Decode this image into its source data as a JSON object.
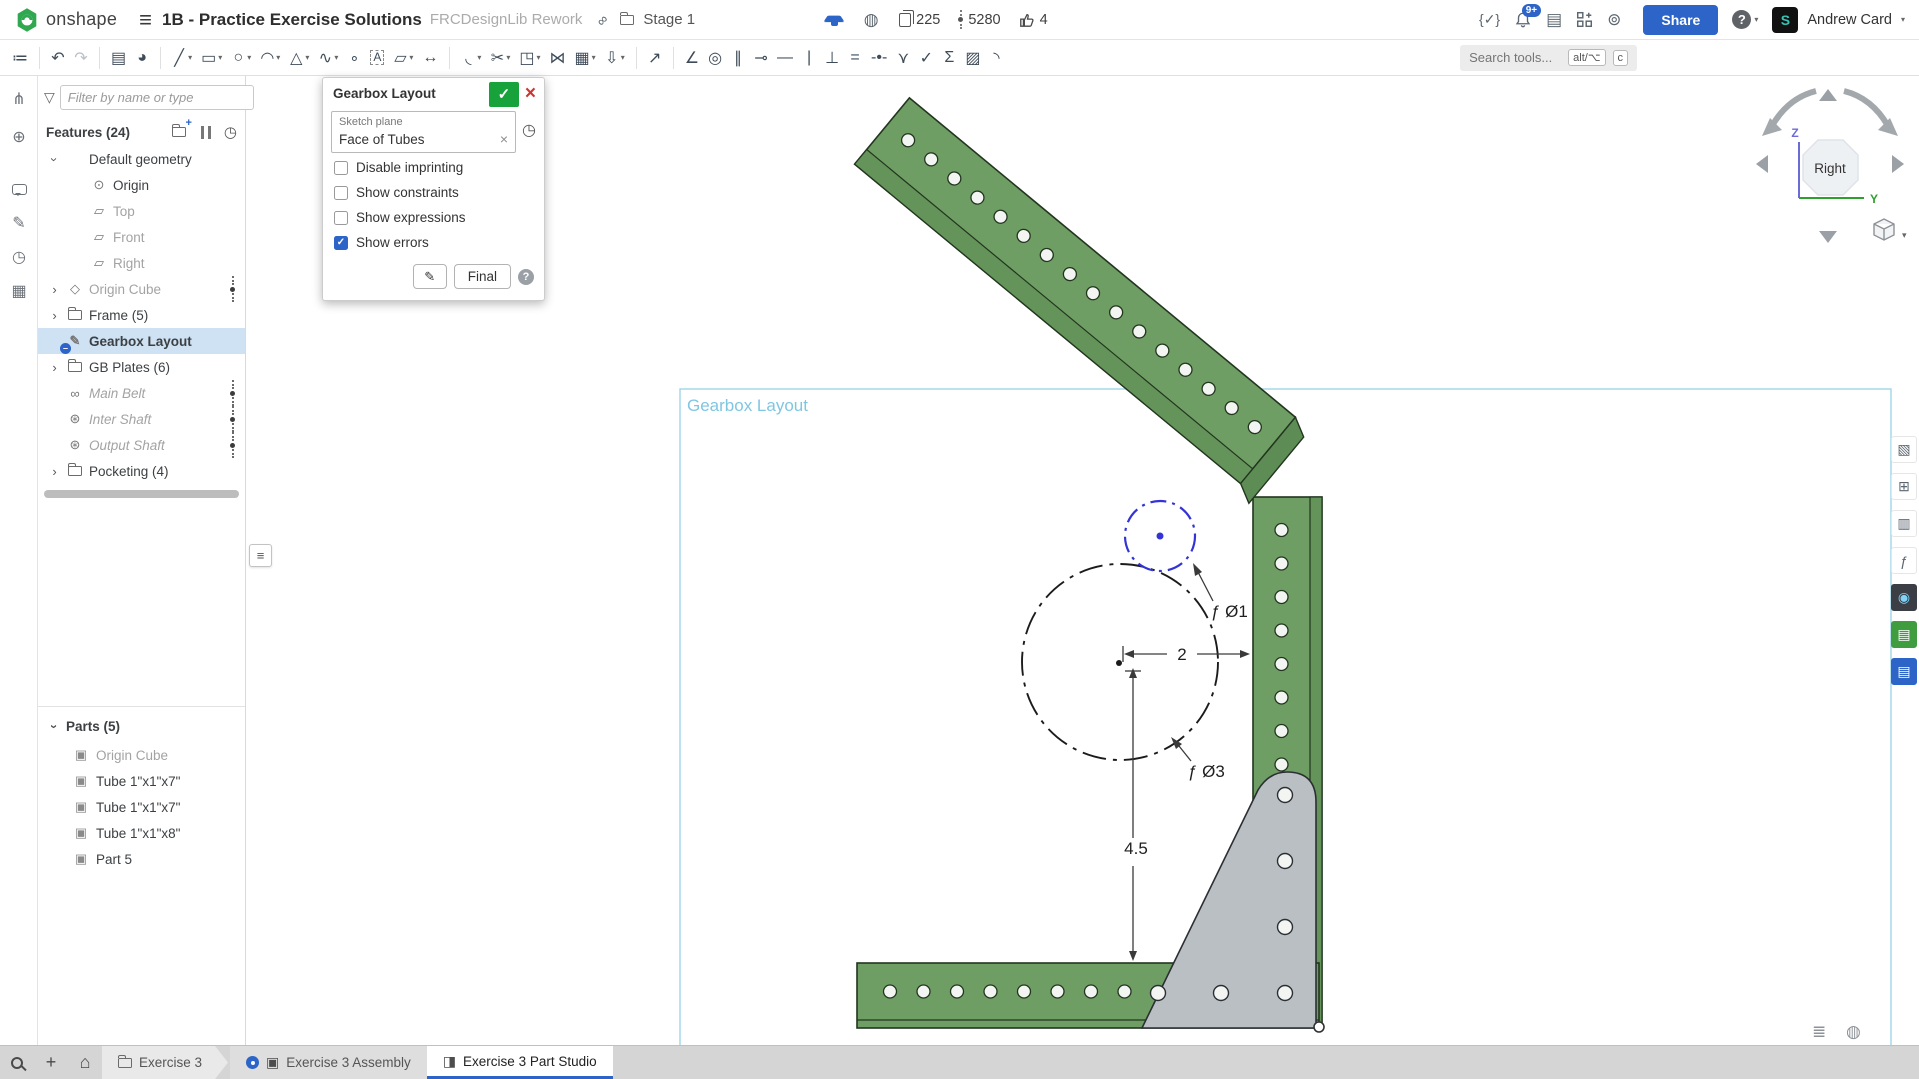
{
  "header": {
    "logo_text": "onshape",
    "title": "1B - Practice Exercise Solutions",
    "subtitle": "FRCDesignLib Rework",
    "folder_label": "Stage 1",
    "stat_copies": "225",
    "stat_points": "5280",
    "stat_likes": "4",
    "notification_badge": "9+",
    "share_label": "Share",
    "user_name": "Andrew Card",
    "avatar_initial": "S"
  },
  "toolbar": {
    "search_placeholder": "Search tools...",
    "kbd_alt": "alt/⌥",
    "kbd_c": "c",
    "caret_glyph": "▾",
    "tools": [
      {
        "name": "feature-list-toggle-icon",
        "glyph": "≔"
      },
      {
        "div": true
      },
      {
        "name": "undo-icon",
        "glyph": "↶"
      },
      {
        "name": "redo-icon",
        "glyph": "↷",
        "dim": true
      },
      {
        "div": true
      },
      {
        "name": "copy-properties-icon",
        "glyph": "▤"
      },
      {
        "name": "appearance-tool-icon",
        "glyph": "◕"
      },
      {
        "div": true
      },
      {
        "name": "line-tool-icon",
        "glyph": "╱",
        "caret": true
      },
      {
        "name": "rectangle-tool-icon",
        "glyph": "▭",
        "caret": true
      },
      {
        "name": "circle-tool-icon",
        "glyph": "○",
        "caret": true
      },
      {
        "name": "arc-tool-icon",
        "glyph": "◠",
        "caret": true
      },
      {
        "name": "polygon-tool-icon",
        "glyph": "△",
        "caret": true
      },
      {
        "name": "spline-tool-icon",
        "glyph": "∿",
        "caret": true
      },
      {
        "name": "point-tool-icon",
        "glyph": "∘"
      },
      {
        "name": "text-tool-icon",
        "glyph": "A",
        "box": true
      },
      {
        "name": "slot-tool-icon",
        "glyph": "▱",
        "caret": true
      },
      {
        "name": "dimension-tool-icon",
        "glyph": "↔"
      },
      {
        "div": true
      },
      {
        "name": "fillet-tool-icon",
        "glyph": "◟",
        "caret": true
      },
      {
        "name": "trim-tool-icon",
        "glyph": "✂",
        "caret": true
      },
      {
        "name": "offset-tool-icon",
        "glyph": "◳",
        "caret": true
      },
      {
        "name": "mirror-tool-icon",
        "glyph": "⋈"
      },
      {
        "name": "pattern-tool-icon",
        "glyph": "▦",
        "caret": true
      },
      {
        "name": "import-dxf-icon",
        "glyph": "⇩",
        "caret": true
      },
      {
        "div": true
      },
      {
        "name": "measure-icon",
        "glyph": "↗"
      },
      {
        "div": true
      },
      {
        "name": "coincident-constraint-icon",
        "glyph": "∠"
      },
      {
        "name": "concentric-constraint-icon",
        "glyph": "◎"
      },
      {
        "name": "parallel-constraint-icon",
        "glyph": "∥"
      },
      {
        "name": "tangent-constraint-icon",
        "glyph": "⊸"
      },
      {
        "name": "horizontal-constraint-icon",
        "glyph": "—"
      },
      {
        "name": "vertical-constraint-icon",
        "glyph": "|"
      },
      {
        "name": "perpendicular-constraint-icon",
        "glyph": "⊥"
      },
      {
        "name": "equal-constraint-icon",
        "glyph": "="
      },
      {
        "name": "midpoint-constraint-icon",
        "glyph": "-•-"
      },
      {
        "name": "pierce-constraint-icon",
        "glyph": "⋎"
      },
      {
        "name": "normal-constraint-icon",
        "glyph": "✓"
      },
      {
        "name": "sketch-expressions-icon",
        "glyph": "Σ"
      },
      {
        "name": "fix-constraint-icon",
        "glyph": "▨"
      },
      {
        "name": "curvature-comb-icon",
        "glyph": "◝"
      }
    ]
  },
  "left_strip": {
    "items": [
      {
        "name": "versions-icon",
        "glyph": "⋔"
      },
      {
        "name": "follow-mode-icon",
        "glyph": "⊕"
      },
      {
        "name": "comments-icon",
        "type": "bubble"
      },
      {
        "name": "feedback-icon",
        "glyph": "✎"
      },
      {
        "name": "history-icon",
        "glyph": "◷"
      },
      {
        "name": "tables-icon",
        "glyph": "▦"
      }
    ]
  },
  "features_panel": {
    "filter_placeholder": "Filter by name or type",
    "features_header": "Features (24)",
    "items": [
      {
        "label": "Default geometry",
        "chevron": "open"
      },
      {
        "label": "Origin",
        "icon": "origin",
        "child": true
      },
      {
        "label": "Top",
        "icon": "plane",
        "child": true,
        "gray": true
      },
      {
        "label": "Front",
        "icon": "plane",
        "child": true,
        "gray": true
      },
      {
        "label": "Right",
        "icon": "plane",
        "child": true,
        "gray": true
      },
      {
        "label": "Origin Cube",
        "icon": "cube",
        "chevron": "closed",
        "gray": true,
        "dots": true
      },
      {
        "label": "Frame (5)",
        "icon": "folder",
        "chevron": "closed"
      },
      {
        "label": "Gearbox Layout",
        "icon": "sketch",
        "selected": true,
        "badge": "–"
      },
      {
        "label": "GB Plates (6)",
        "icon": "folder",
        "chevron": "closed"
      },
      {
        "label": "Main Belt",
        "icon": "belt",
        "gray": true,
        "italic": true,
        "dots": true
      },
      {
        "label": "Inter Shaft",
        "icon": "gear",
        "gray": true,
        "italic": true,
        "dots": true
      },
      {
        "label": "Output Shaft",
        "icon": "gear",
        "gray": true,
        "italic": true,
        "dots": true
      },
      {
        "label": "Pocketing (4)",
        "icon": "folder",
        "chevron": "closed"
      }
    ],
    "parts_header": "Parts (5)",
    "parts": [
      {
        "label": "Origin Cube",
        "gray": true
      },
      {
        "label": "Tube 1\"x1\"x7\""
      },
      {
        "label": "Tube 1\"x1\"x7\""
      },
      {
        "label": "Tube 1\"x1\"x8\""
      },
      {
        "label": "Part 5"
      }
    ]
  },
  "dialog": {
    "title": "Gearbox Layout",
    "sketch_plane_label": "Sketch plane",
    "sketch_plane_value": "Face of Tubes",
    "checkboxes": [
      {
        "label": "Disable imprinting",
        "checked": false
      },
      {
        "label": "Show constraints",
        "checked": false
      },
      {
        "label": "Show expressions",
        "checked": false
      },
      {
        "label": "Show errors",
        "checked": true
      }
    ],
    "final_label": "Final"
  },
  "canvas": {
    "sketch_label": "Gearbox Layout",
    "dim_diameter1": "ƒ Ø1",
    "dim_width": "2",
    "dim_diameter3": "ƒ Ø3",
    "dim_height": "4.5",
    "viewcube_face": "Right",
    "axis_z": "Z",
    "axis_y": "Y"
  },
  "right_strip": {
    "items": [
      {
        "name": "appearance-panel-icon",
        "glyph": "▧"
      },
      {
        "name": "configurations-panel-icon",
        "glyph": "⊞"
      },
      {
        "name": "custom-tables-panel-icon",
        "glyph": "▥"
      },
      {
        "name": "featurescript-panel-icon",
        "glyph": "ƒ"
      },
      {
        "name": "ai-advisor-icon",
        "glyph": "◉",
        "bg": "#3b3e45",
        "fg": "#7fd3f7"
      },
      {
        "name": "learning-center-icon",
        "glyph": "▤",
        "bg": "#3f9d3f",
        "fg": "#ffffff"
      },
      {
        "name": "documentation-icon",
        "glyph": "▤",
        "bg": "#2d64c8",
        "fg": "#ffffff"
      }
    ]
  },
  "tabs": {
    "items": [
      {
        "label": "Exercise 3"
      },
      {
        "label": "Exercise 3 Assembly"
      },
      {
        "label": "Exercise 3 Part Studio",
        "active": true
      }
    ]
  },
  "colors": {
    "accent": "#2d64c8",
    "tube_green": "#6f9e64",
    "tube_side_green": "#649459",
    "tube_end_green": "#5e8c55",
    "outline_dark": "#22351f",
    "gusset_gray": "#babfc4",
    "hole_fill": "#f2f5f1",
    "sketch_entity_blue": "#3434d6",
    "sketch_frame_cyan": "#9fd6ea",
    "selection_bg": "#cfe2f4",
    "success_green": "#18a23b",
    "error_red": "#d0342c"
  }
}
